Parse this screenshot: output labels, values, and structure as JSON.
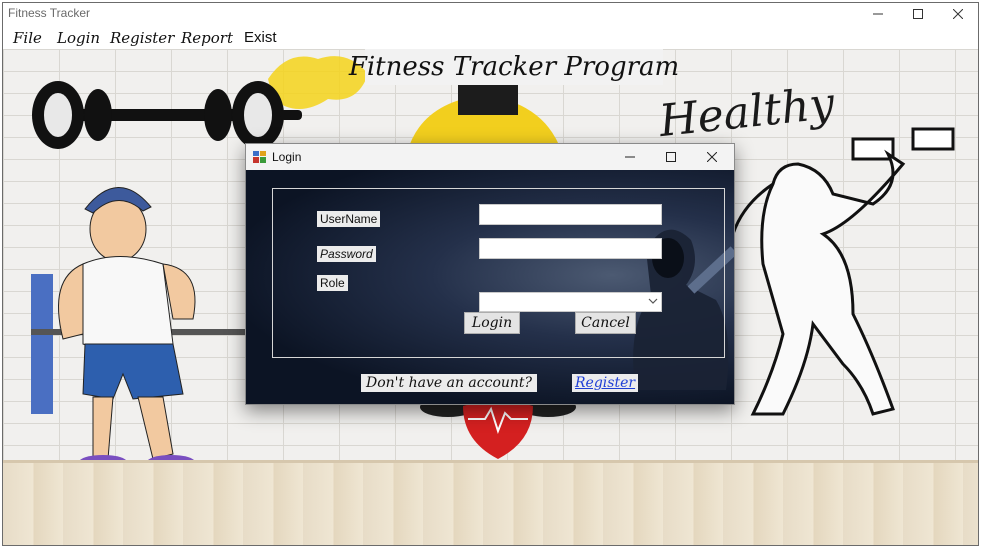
{
  "window": {
    "title": "Fitness Tracker"
  },
  "menu": {
    "file": "File",
    "login": "Login",
    "register": "Register",
    "report": "Report",
    "exist": "Exist"
  },
  "background": {
    "title": "Fitness Tracker Program",
    "wall_text": "Healthy"
  },
  "dialog": {
    "title": "Login",
    "username_label": "UserName",
    "password_label": "Password",
    "role_label": "Role",
    "username_value": "",
    "password_value": "",
    "role_value": "",
    "login_button": "Login",
    "cancel_button": "Cancel",
    "no_account_text": "Don't have an account?",
    "register_link": "Register"
  },
  "icons": {
    "window_minimize": "minimize-icon",
    "window_maximize": "maximize-icon",
    "window_close": "close-icon",
    "dialog_app": "app-icon",
    "combo_arrow": "chevron-down-icon"
  }
}
